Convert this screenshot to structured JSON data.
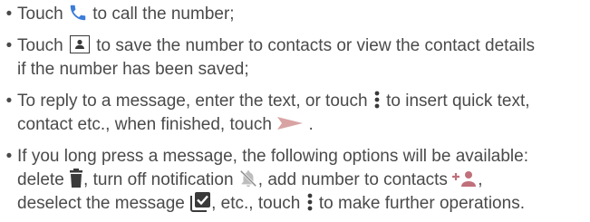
{
  "bullet_char": "•",
  "items": [
    {
      "l1a": "Touch ",
      "l1b": " to call the number;"
    },
    {
      "l1a": "Touch ",
      "l1b": " to save the number to contacts or view the contact details",
      "l2": "if the number has been saved;"
    },
    {
      "l1a": "To reply to a message, enter the text, or touch ",
      "l1b": " to insert quick text,",
      "l2a": "contact etc., when finished, touch ",
      "l2b": " ."
    },
    {
      "l1": "If you long press a message, the following options will be available:",
      "l2a": "delete ",
      "l2b": ", turn off notification ",
      "l2c": ", add number to contacts ",
      "l2d": ",",
      "l3a": "deselect the message ",
      "l3b": ", etc., touch ",
      "l3c": " to make further operations."
    }
  ],
  "icons": {
    "call": "phone-icon",
    "contact": "contact-icon",
    "more": "more-vertical-icon",
    "send": "send-icon",
    "delete": "trash-icon",
    "mute": "notification-off-icon",
    "add_contact": "add-contact-icon",
    "deselect": "checkbox-icon"
  },
  "colors": {
    "text": "#4a4a4a",
    "icon_dark": "#3a3a3a",
    "call_blue": "#3b7dd8",
    "send_pink": "#d9a3a3",
    "add_contact_pink": "#c0707a"
  }
}
